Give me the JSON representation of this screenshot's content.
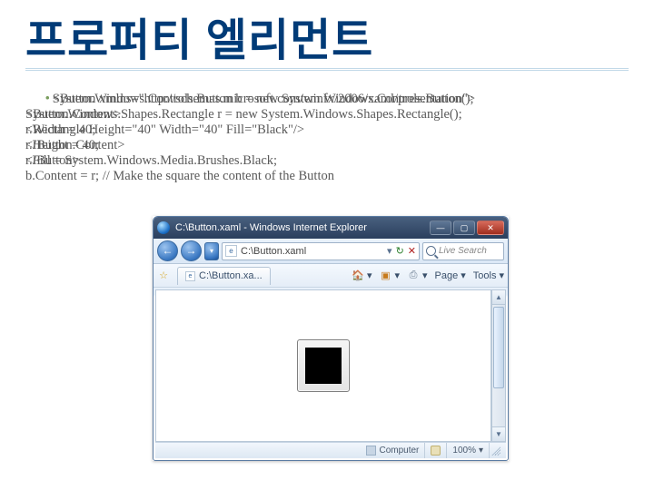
{
  "title": "프로퍼티 엘리먼트",
  "code_layer_a": "<Button xmlns=\"http://schemas.microsoft.com/winfx/2006/xaml/presentation\">\n<Button.Content>\n<Rectangle Height=\"40\" Width=\"40\" Fill=\"Black\"/>\n</Button.Content>\n</Button>",
  "code_layer_b": "System.Windows.Controls.Button b = new System.Windows.Controls.Button();\nSystem.Windows.Shapes.Rectangle r = new System.Windows.Shapes.Rectangle();\nr.Width = 40;\nr.Height = 40;\nr.Fill = System.Windows.Media.Brushes.Black;\nb.Content = r; // Make the square the content of the Button",
  "browser": {
    "window_title": "C:\\Button.xaml - Windows Internet Explorer",
    "min": "—",
    "max": "▢",
    "close": "✕",
    "back": "←",
    "fwd": "→",
    "drop": "▾",
    "address": "C:\\Button.xaml",
    "addr_drop": "▾",
    "refresh": "↻",
    "stop": "✕",
    "search_placeholder": "Live Search",
    "tab_label": "C:\\Button.xa...",
    "favs": "☆",
    "home": "🏠",
    "feeds": "▣",
    "print": "⎙",
    "page": "Page",
    "tools": "Tools",
    "scroll_up": "▲",
    "scroll_dn": "▼",
    "status_computer": "Computer",
    "status_zone": "",
    "status_zoom": "100%"
  }
}
